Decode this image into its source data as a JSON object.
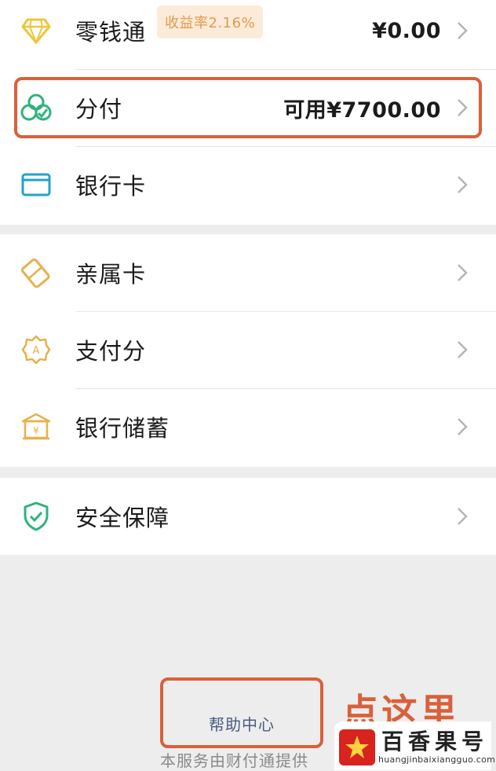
{
  "menu_group_1": {
    "items": [
      {
        "label": "零钱通",
        "badge": "收益率2.16%",
        "value": "¥0.00",
        "icon": "diamond-icon"
      },
      {
        "label": "分付",
        "value": "可用¥7700.00",
        "icon": "fenfu-clover-icon"
      },
      {
        "label": "银行卡",
        "icon": "bank-card-icon"
      }
    ]
  },
  "menu_group_2": {
    "items": [
      {
        "label": "亲属卡",
        "icon": "family-card-icon"
      },
      {
        "label": "支付分",
        "icon": "payscore-icon"
      },
      {
        "label": "银行储蓄",
        "icon": "bank-savings-icon"
      }
    ]
  },
  "menu_group_3": {
    "items": [
      {
        "label": "安全保障",
        "icon": "shield-icon"
      }
    ]
  },
  "help": {
    "label": "帮助中心"
  },
  "footer": {
    "text": "本服务由财付通提供"
  },
  "annotation": {
    "text": "点这里"
  },
  "watermark": {
    "title": "百香果号",
    "url": "huangjinbaixiangguo.com"
  },
  "colors": {
    "highlight": "#d9603a",
    "badge_bg": "#fdebd9",
    "badge_text": "#e39a4e",
    "icon_green": "#2fb37b",
    "icon_gold": "#e8b04c",
    "icon_teal": "#23a3c8",
    "icon_yellow": "#f0c73a"
  }
}
